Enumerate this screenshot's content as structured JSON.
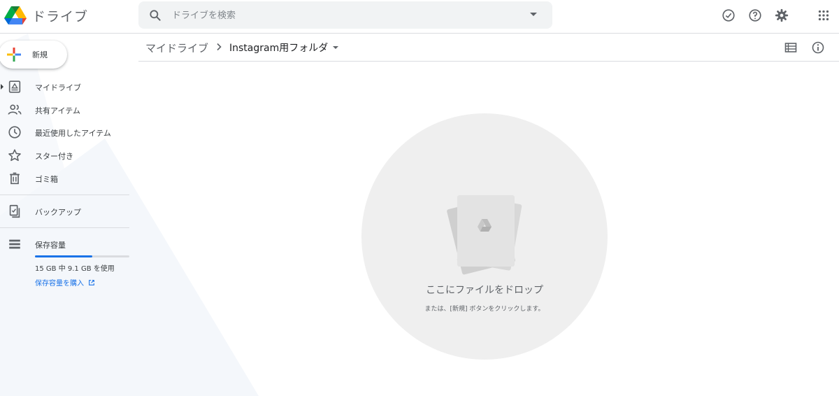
{
  "header": {
    "app_title": "ドライブ",
    "search_placeholder": "ドライブを検索"
  },
  "sidebar": {
    "new_label": "新規",
    "items": [
      {
        "label": "マイドライブ",
        "icon": "my-drive-icon"
      },
      {
        "label": "共有アイテム",
        "icon": "people-icon"
      },
      {
        "label": "最近使用したアイテム",
        "icon": "clock-icon"
      },
      {
        "label": "スター付き",
        "icon": "star-icon"
      },
      {
        "label": "ゴミ箱",
        "icon": "trash-icon"
      },
      {
        "label": "バックアップ",
        "icon": "backup-icon"
      },
      {
        "label": "保存容量",
        "icon": "storage-icon"
      }
    ],
    "storage": {
      "used_fraction": 0.61,
      "text": "15 GB 中 9.1 GB を使用",
      "buy_label": "保存容量を購入"
    }
  },
  "main": {
    "breadcrumb": {
      "root": "マイドライブ",
      "current": "Instagram用フォルダ"
    },
    "empty_state": {
      "title": "ここにファイルをドロップ",
      "hint": "または、[新規] ボタンをクリックします。"
    }
  },
  "colors": {
    "accent": "#1a73e8",
    "icon": "#5f6368",
    "drop_zone": "#efefef"
  }
}
